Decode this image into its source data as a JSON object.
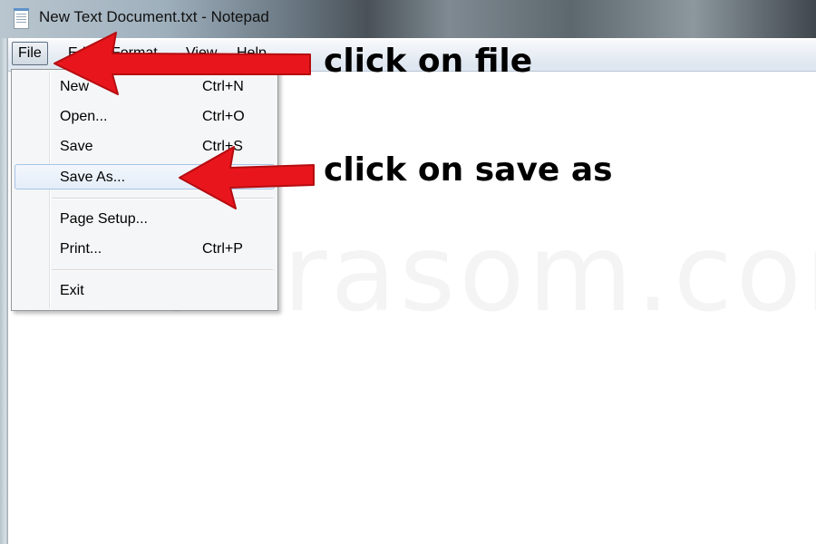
{
  "window": {
    "title": "New Text Document.txt - Notepad"
  },
  "menubar": {
    "file": "File",
    "edit": "Edit",
    "format": "Format",
    "view": "View",
    "help": "Help"
  },
  "file_menu": {
    "items": [
      {
        "label": "New",
        "shortcut": "Ctrl+N"
      },
      {
        "label": "Open...",
        "shortcut": "Ctrl+O"
      },
      {
        "label": "Save",
        "shortcut": "Ctrl+S"
      },
      {
        "label": "Save As...",
        "shortcut": ""
      },
      {
        "label": "Page Setup...",
        "shortcut": ""
      },
      {
        "label": "Print...",
        "shortcut": "Ctrl+P"
      },
      {
        "label": "Exit",
        "shortcut": ""
      }
    ],
    "highlighted": "Save As..."
  },
  "annotations": {
    "step1": "click on file",
    "step2": "click on save as",
    "arrow_color": "#e8161c"
  },
  "watermark": "subhrasom.com"
}
